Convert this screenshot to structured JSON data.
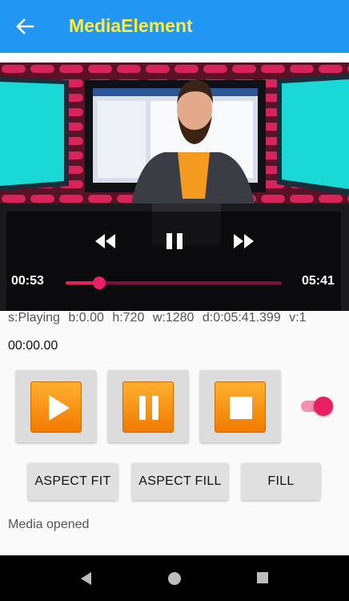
{
  "app_bar": {
    "title": "MediaElement",
    "back_icon": "arrow-back-icon"
  },
  "player": {
    "current_time": "00:53",
    "duration": "05:41",
    "progress_fraction": 0.155,
    "accent_color": "#E91E63"
  },
  "status": {
    "state": "s:Playing",
    "buffering": "b:0.00",
    "height": "h:720",
    "width": "w:1280",
    "duration": "d:0:05:41.399",
    "volume": "v:1"
  },
  "position_text": "00:00.00",
  "media_buttons": {
    "play_icon": "play-icon",
    "pause_icon": "pause-icon",
    "stop_icon": "stop-icon"
  },
  "toggle": {
    "on": true
  },
  "aspect_buttons": {
    "fit": "ASPECT FIT",
    "fill": "ASPECT FILL",
    "stretch": "FILL"
  },
  "message": "Media opened",
  "colors": {
    "app_bar": "#2196F3",
    "title": "#FFEB3B",
    "button_orange": "#F57C00"
  }
}
